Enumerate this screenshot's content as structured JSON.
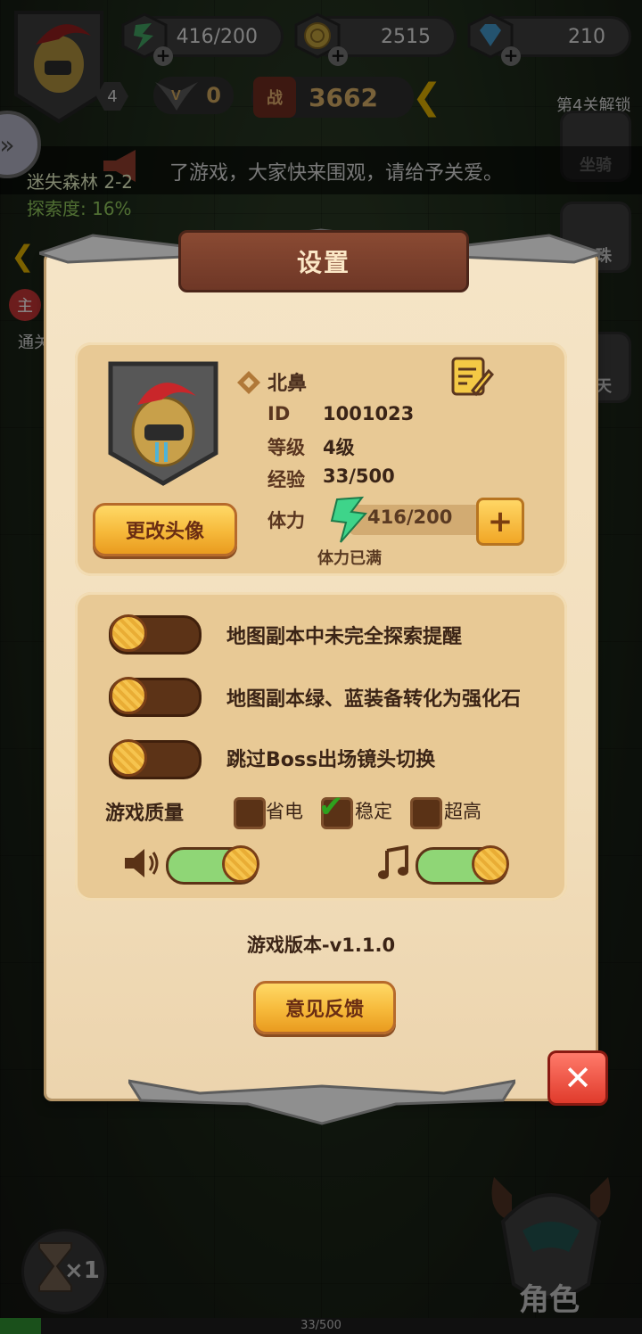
{
  "hud": {
    "player_level": "4",
    "stamina": "416/200",
    "gold": "2515",
    "diamonds": "210",
    "vip": "0",
    "power_badge": "战",
    "power": "3662",
    "unlock_notice": "第4关解锁",
    "mount_label": "坐骑",
    "pearl_label": "宝珠",
    "chat_label": "聊天",
    "ticker": "了游戏，大家快来围观，请给予关爱。",
    "zone_name": "迷失森林 2-2",
    "explore_progress": "探索度: 16%",
    "main_badge": "主",
    "main_sub": "通关",
    "speed": "×1",
    "role_label": "角色",
    "xp_text": "33/500"
  },
  "settings": {
    "title": "设置",
    "profile": {
      "name": "北鼻",
      "id_label": "ID",
      "id_value": "1001023",
      "level_label": "等级",
      "level_value": "4级",
      "exp_label": "经验",
      "exp_value": "33/500",
      "stamina_label": "体力",
      "stamina_value": "416/200",
      "stamina_status": "体力已满",
      "change_avatar": "更改头像"
    },
    "options": [
      {
        "label": "地图副本中未完全探索提醒",
        "enabled": false
      },
      {
        "label": "地图副本绿、蓝装备转化为强化石",
        "enabled": false
      },
      {
        "label": "跳过Boss出场镜头切换",
        "enabled": false
      }
    ],
    "quality": {
      "label": "游戏质量",
      "choices": [
        "省电",
        "稳定",
        "超高"
      ],
      "selected": "稳定"
    },
    "sound_enabled": true,
    "music_enabled": true,
    "version": "游戏版本-v1.1.0",
    "feedback": "意见反馈"
  },
  "colors": {
    "panel_bg": "#f2dfbd",
    "card_bg": "#e8c995",
    "gold_button": "#f6b93a",
    "toggle_on": "#8fd676",
    "close_red": "#e03b2c"
  }
}
